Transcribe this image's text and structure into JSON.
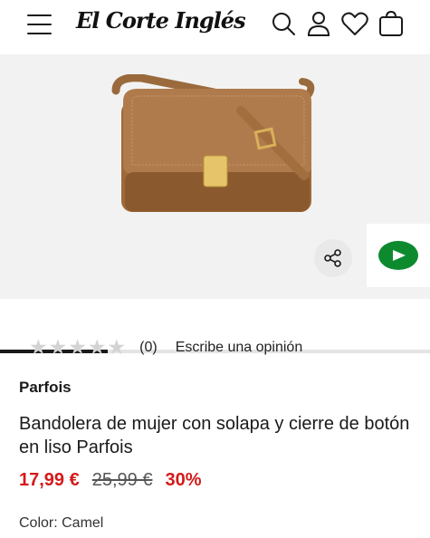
{
  "header": {
    "logo_text": "El Corte Inglés",
    "icons": [
      "menu-icon",
      "search-icon",
      "user-icon",
      "heart-icon",
      "bag-icon"
    ]
  },
  "gallery": {
    "image": "camel leather crossbody bag",
    "progress": 0.25,
    "share_icon": "share-icon",
    "play_icon": "play-icon",
    "play_color": "#0d8a2e"
  },
  "product": {
    "rating": {
      "stars": 0,
      "max_stars": 5,
      "count": "(0)",
      "write_review": "Escribe una opinión"
    },
    "brand": "Parfois",
    "title": "Bandolera de mujer con solapa y cierre de botón en liso Parfois",
    "price_sale": "17,99 €",
    "price_original": "25,99 €",
    "discount": "30%",
    "color": "Color: Camel"
  },
  "colors": {
    "sale_red": "#d41a1a",
    "gallery_bg": "#f2f2f2",
    "star_empty": "#d3d3d3"
  }
}
